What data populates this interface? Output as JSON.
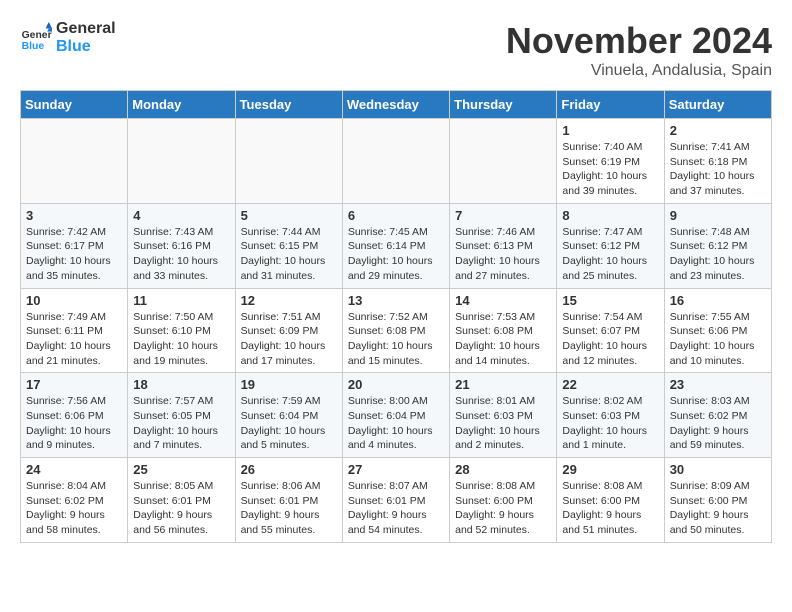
{
  "header": {
    "logo": {
      "line1": "General",
      "line2": "Blue"
    },
    "title": "November 2024",
    "subtitle": "Vinuela, Andalusia, Spain"
  },
  "weekdays": [
    "Sunday",
    "Monday",
    "Tuesday",
    "Wednesday",
    "Thursday",
    "Friday",
    "Saturday"
  ],
  "weeks": [
    [
      {
        "day": "",
        "empty": true
      },
      {
        "day": "",
        "empty": true
      },
      {
        "day": "",
        "empty": true
      },
      {
        "day": "",
        "empty": true
      },
      {
        "day": "",
        "empty": true
      },
      {
        "day": "1",
        "sunrise": "7:40 AM",
        "sunset": "6:19 PM",
        "daylight": "10 hours and 39 minutes."
      },
      {
        "day": "2",
        "sunrise": "7:41 AM",
        "sunset": "6:18 PM",
        "daylight": "10 hours and 37 minutes."
      }
    ],
    [
      {
        "day": "3",
        "sunrise": "7:42 AM",
        "sunset": "6:17 PM",
        "daylight": "10 hours and 35 minutes."
      },
      {
        "day": "4",
        "sunrise": "7:43 AM",
        "sunset": "6:16 PM",
        "daylight": "10 hours and 33 minutes."
      },
      {
        "day": "5",
        "sunrise": "7:44 AM",
        "sunset": "6:15 PM",
        "daylight": "10 hours and 31 minutes."
      },
      {
        "day": "6",
        "sunrise": "7:45 AM",
        "sunset": "6:14 PM",
        "daylight": "10 hours and 29 minutes."
      },
      {
        "day": "7",
        "sunrise": "7:46 AM",
        "sunset": "6:13 PM",
        "daylight": "10 hours and 27 minutes."
      },
      {
        "day": "8",
        "sunrise": "7:47 AM",
        "sunset": "6:12 PM",
        "daylight": "10 hours and 25 minutes."
      },
      {
        "day": "9",
        "sunrise": "7:48 AM",
        "sunset": "6:12 PM",
        "daylight": "10 hours and 23 minutes."
      }
    ],
    [
      {
        "day": "10",
        "sunrise": "7:49 AM",
        "sunset": "6:11 PM",
        "daylight": "10 hours and 21 minutes."
      },
      {
        "day": "11",
        "sunrise": "7:50 AM",
        "sunset": "6:10 PM",
        "daylight": "10 hours and 19 minutes."
      },
      {
        "day": "12",
        "sunrise": "7:51 AM",
        "sunset": "6:09 PM",
        "daylight": "10 hours and 17 minutes."
      },
      {
        "day": "13",
        "sunrise": "7:52 AM",
        "sunset": "6:08 PM",
        "daylight": "10 hours and 15 minutes."
      },
      {
        "day": "14",
        "sunrise": "7:53 AM",
        "sunset": "6:08 PM",
        "daylight": "10 hours and 14 minutes."
      },
      {
        "day": "15",
        "sunrise": "7:54 AM",
        "sunset": "6:07 PM",
        "daylight": "10 hours and 12 minutes."
      },
      {
        "day": "16",
        "sunrise": "7:55 AM",
        "sunset": "6:06 PM",
        "daylight": "10 hours and 10 minutes."
      }
    ],
    [
      {
        "day": "17",
        "sunrise": "7:56 AM",
        "sunset": "6:06 PM",
        "daylight": "10 hours and 9 minutes."
      },
      {
        "day": "18",
        "sunrise": "7:57 AM",
        "sunset": "6:05 PM",
        "daylight": "10 hours and 7 minutes."
      },
      {
        "day": "19",
        "sunrise": "7:59 AM",
        "sunset": "6:04 PM",
        "daylight": "10 hours and 5 minutes."
      },
      {
        "day": "20",
        "sunrise": "8:00 AM",
        "sunset": "6:04 PM",
        "daylight": "10 hours and 4 minutes."
      },
      {
        "day": "21",
        "sunrise": "8:01 AM",
        "sunset": "6:03 PM",
        "daylight": "10 hours and 2 minutes."
      },
      {
        "day": "22",
        "sunrise": "8:02 AM",
        "sunset": "6:03 PM",
        "daylight": "10 hours and 1 minute."
      },
      {
        "day": "23",
        "sunrise": "8:03 AM",
        "sunset": "6:02 PM",
        "daylight": "9 hours and 59 minutes."
      }
    ],
    [
      {
        "day": "24",
        "sunrise": "8:04 AM",
        "sunset": "6:02 PM",
        "daylight": "9 hours and 58 minutes."
      },
      {
        "day": "25",
        "sunrise": "8:05 AM",
        "sunset": "6:01 PM",
        "daylight": "9 hours and 56 minutes."
      },
      {
        "day": "26",
        "sunrise": "8:06 AM",
        "sunset": "6:01 PM",
        "daylight": "9 hours and 55 minutes."
      },
      {
        "day": "27",
        "sunrise": "8:07 AM",
        "sunset": "6:01 PM",
        "daylight": "9 hours and 54 minutes."
      },
      {
        "day": "28",
        "sunrise": "8:08 AM",
        "sunset": "6:00 PM",
        "daylight": "9 hours and 52 minutes."
      },
      {
        "day": "29",
        "sunrise": "8:08 AM",
        "sunset": "6:00 PM",
        "daylight": "9 hours and 51 minutes."
      },
      {
        "day": "30",
        "sunrise": "8:09 AM",
        "sunset": "6:00 PM",
        "daylight": "9 hours and 50 minutes."
      }
    ]
  ]
}
